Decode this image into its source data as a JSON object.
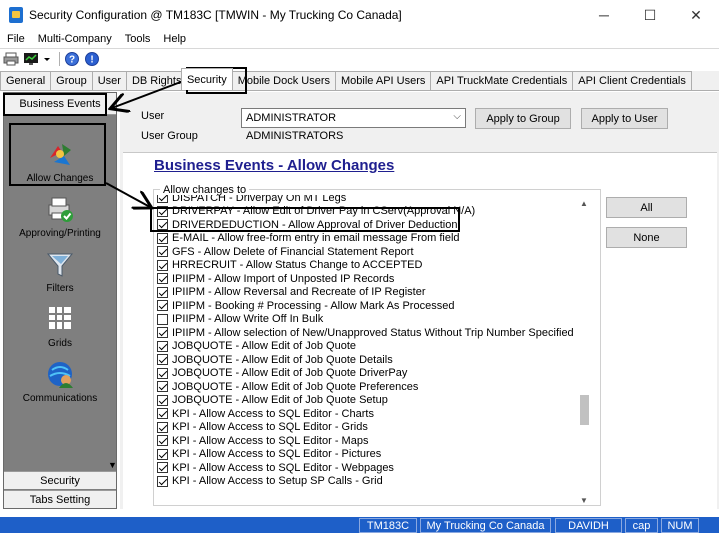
{
  "window": {
    "title": "Security Configuration @ TM183C [TMWIN - My Trucking Co Canada]",
    "minimize": "─",
    "maximize": "☐",
    "close": "✕"
  },
  "menu": [
    "File",
    "Multi-Company",
    "Tools",
    "Help"
  ],
  "toolbar": {
    "icons": [
      "printer-icon",
      "monitor-icon",
      "dropdown-icon",
      "help-icon",
      "info-icon"
    ]
  },
  "tabs": [
    "General",
    "Group",
    "User",
    "DB Rights",
    "Security",
    "Mobile Dock Users",
    "Mobile API Users",
    "API TruckMate Credentials",
    "API Client Credentials"
  ],
  "active_tab": "Security",
  "sidebar": {
    "header": "Business Events",
    "items": [
      {
        "label": "Allow Changes",
        "icon": "allow-changes-icon"
      },
      {
        "label": "Approving/Printing",
        "icon": "approving-printing-icon"
      },
      {
        "label": "Filters",
        "icon": "filter-icon"
      },
      {
        "label": "Grids",
        "icon": "grid-icon"
      },
      {
        "label": "Communications",
        "icon": "communications-icon"
      }
    ],
    "bottom_buttons": [
      "Security",
      "Tabs Setting"
    ]
  },
  "form": {
    "user_label": "User",
    "user_value": "ADMINISTRATOR",
    "group_label": "User Group",
    "group_value": "ADMINISTRATORS",
    "apply_group": "Apply to Group",
    "apply_user": "Apply to User"
  },
  "panel": {
    "title": "Business Events - Allow Changes",
    "group_label": "Allow changes to",
    "all_button": "All",
    "none_button": "None",
    "items": [
      {
        "label": "DISPATCH - Driverpay On MT Legs",
        "checked": true
      },
      {
        "label": "DRIVERPAY - Allow Edit of Driver Pay in CServ(Approval N/A)",
        "checked": true
      },
      {
        "label": "DRIVERDEDUCTION - Allow Approval of Driver Deduction",
        "checked": true
      },
      {
        "label": "E-MAIL - Allow free-form entry in email message From field",
        "checked": true
      },
      {
        "label": "GFS -  Allow Delete of Financial Statement Report",
        "checked": true
      },
      {
        "label": "HRRECRUIT - Allow Status Change to ACCEPTED",
        "checked": true
      },
      {
        "label": "IPIIPM - Allow Import of Unposted IP Records",
        "checked": true
      },
      {
        "label": "IPIIPM - Allow Reversal and Recreate of IP Register",
        "checked": true
      },
      {
        "label": "IPIIPM - Booking # Processing - Allow Mark As Processed",
        "checked": true
      },
      {
        "label": "IPIIPM - Allow Write Off In Bulk",
        "checked": false
      },
      {
        "label": "IPIIPM - Allow selection of New/Unapproved Status Without Trip Number Specified",
        "checked": true
      },
      {
        "label": "JOBQUOTE - Allow Edit of Job Quote",
        "checked": true
      },
      {
        "label": "JOBQUOTE - Allow Edit of Job Quote Details",
        "checked": true
      },
      {
        "label": "JOBQUOTE - Allow Edit of Job Quote DriverPay",
        "checked": true
      },
      {
        "label": "JOBQUOTE - Allow Edit of Job Quote Preferences",
        "checked": true
      },
      {
        "label": "JOBQUOTE - Allow Edit of Job Quote Setup",
        "checked": true
      },
      {
        "label": "KPI - Allow Access to SQL Editor - Charts",
        "checked": true
      },
      {
        "label": "KPI - Allow Access to SQL Editor - Grids",
        "checked": true
      },
      {
        "label": "KPI - Allow Access to SQL Editor - Maps",
        "checked": true
      },
      {
        "label": "KPI - Allow Access to SQL Editor - Pictures",
        "checked": true
      },
      {
        "label": "KPI - Allow Access to SQL Editor - Webpages",
        "checked": true
      },
      {
        "label": "KPI - Allow Access to Setup SP Calls - Grid",
        "checked": true
      }
    ]
  },
  "statusbar": [
    "TM183C",
    "My Trucking Co Canada",
    "DAVIDH",
    "cap",
    "NUM"
  ],
  "colors": {
    "statusbar": "#1e5fc8",
    "sidebar": "#7f7f7f",
    "title_link": "#1f1f8f"
  }
}
